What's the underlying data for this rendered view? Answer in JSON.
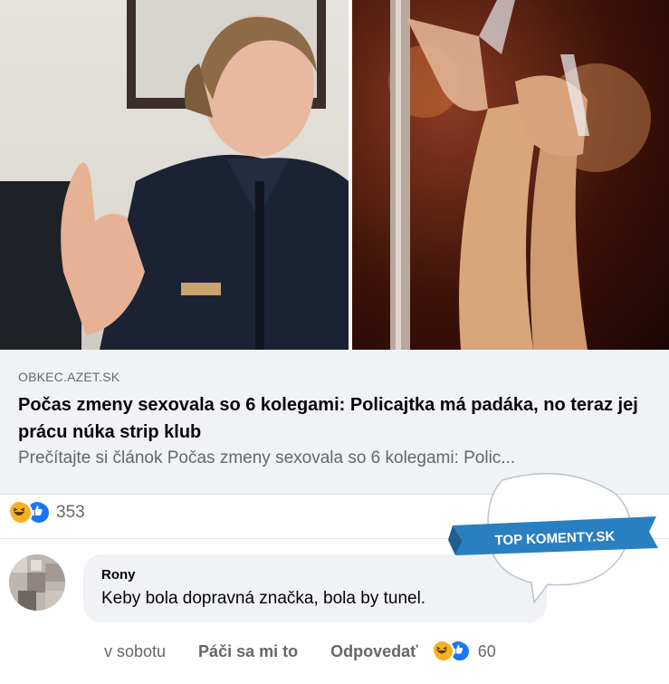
{
  "link_preview": {
    "domain": "OBKEC.AZET.SK",
    "headline": "Počas zmeny sexovala so 6 kolegami: Policajtka má padáka, no teraz jej prácu núka strip klub",
    "excerpt": "Prečítajte si článok Počas zmeny sexovala so 6 kolegami: Polic..."
  },
  "post_reactions": {
    "count": "353"
  },
  "comment": {
    "author": "Rony",
    "text": "Keby bola dopravná značka, bola by tunel.",
    "time": "v sobotu",
    "like_label": "Páči sa mi to",
    "reply_label": "Odpovedať",
    "reaction_count": "60"
  },
  "watermark": {
    "text": "TOP KOMENTY.SK"
  },
  "colors": {
    "accent": "#1877f2",
    "haha": "#f7b125",
    "ribbon": "#2a7fc1"
  }
}
